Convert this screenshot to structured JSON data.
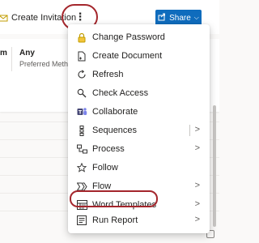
{
  "command_bar": {
    "create_invitation_label": "Create Invitation",
    "more_glyph": "⋮",
    "share_label": "Share",
    "share_chevron": "⌵"
  },
  "form": {
    "field_a_label": "m",
    "any_value": "Any",
    "any_sublabel": "Preferred Method o"
  },
  "menu": {
    "items": [
      {
        "label": "Change Password",
        "icon": "lock-icon",
        "submenu": false
      },
      {
        "label": "Create Document",
        "icon": "document-add-icon",
        "submenu": false
      },
      {
        "label": "Refresh",
        "icon": "refresh-icon",
        "submenu": false
      },
      {
        "label": "Check Access",
        "icon": "search-key-icon",
        "submenu": false
      },
      {
        "label": "Collaborate",
        "icon": "teams-icon",
        "submenu": false
      },
      {
        "label": "Sequences",
        "icon": "sequences-icon",
        "submenu": true
      },
      {
        "label": "Process",
        "icon": "process-icon",
        "submenu": true
      },
      {
        "label": "Follow",
        "icon": "star-icon",
        "submenu": false
      },
      {
        "label": "Flow",
        "icon": "flow-icon",
        "submenu": true
      },
      {
        "label": "Word Templates",
        "icon": "word-templates-icon",
        "submenu": true
      },
      {
        "label": "Run Report",
        "icon": "report-icon",
        "submenu": true
      }
    ],
    "arrow_glyph": ">"
  },
  "colors": {
    "accent": "#0f6cbd",
    "annotation_ring": "#a4262c",
    "lock_icon": "#c19c00"
  }
}
